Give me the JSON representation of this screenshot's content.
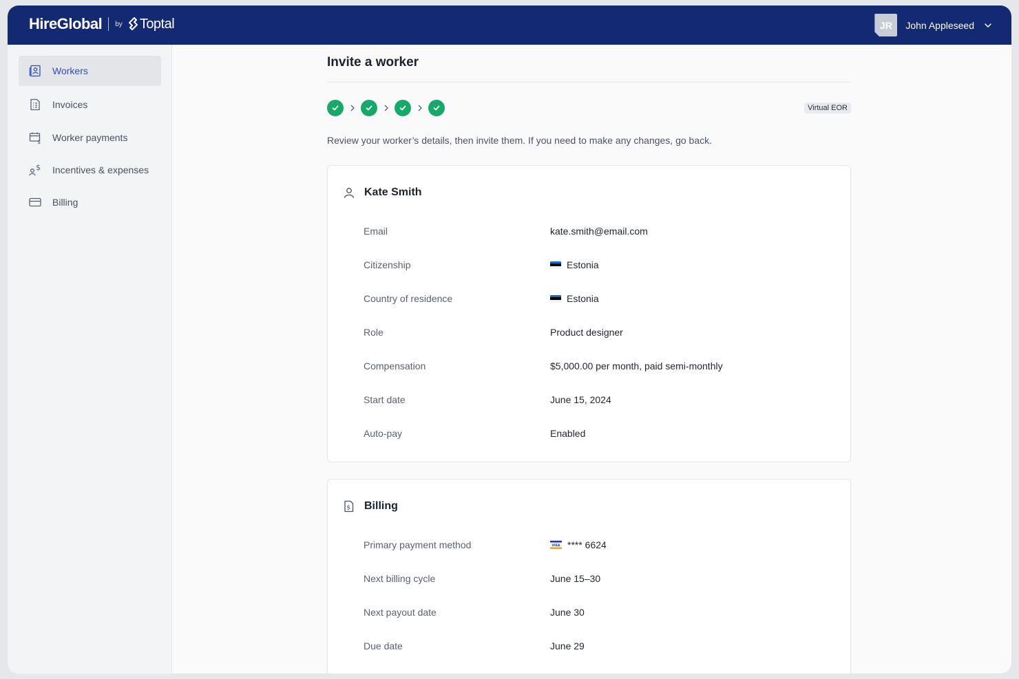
{
  "header": {
    "brand": "HireGlobal",
    "by": "by",
    "partner": "Toptal",
    "user": {
      "initials": "JR",
      "name": "John Appleseed"
    }
  },
  "sidebar": {
    "items": [
      {
        "label": "Workers",
        "icon": "workers-icon",
        "active": true
      },
      {
        "label": "Invoices",
        "icon": "invoices-icon",
        "active": false
      },
      {
        "label": "Worker payments",
        "icon": "worker-payments-icon",
        "active": false
      },
      {
        "label": "Incentives & expenses",
        "icon": "incentives-icon",
        "active": false
      },
      {
        "label": "Billing",
        "icon": "billing-card-icon",
        "active": false
      }
    ]
  },
  "page": {
    "title": "Invite a worker",
    "badge": "Virtual EOR",
    "steps_completed": 4,
    "intro": "Review your worker’s details, then invite them. If you need to make any changes, go back."
  },
  "worker_card": {
    "name": "Kate Smith",
    "rows": [
      {
        "label": "Email",
        "value": "kate.smith@email.com"
      },
      {
        "label": "Citizenship",
        "value": "Estonia",
        "flag": "estonia-flag"
      },
      {
        "label": "Country of residence",
        "value": "Estonia",
        "flag": "estonia-flag"
      },
      {
        "label": "Role",
        "value": "Product designer"
      },
      {
        "label": "Compensation",
        "value": "$5,000.00 per month, paid semi-monthly"
      },
      {
        "label": "Start date",
        "value": "June 15, 2024"
      },
      {
        "label": "Auto-pay",
        "value": "Enabled"
      }
    ]
  },
  "billing_card": {
    "title": "Billing",
    "rows": [
      {
        "label": "Primary payment method",
        "value": "**** 6624",
        "card_brand": "visa-icon"
      },
      {
        "label": "Next billing cycle",
        "value": "June 15–30"
      },
      {
        "label": "Next payout date",
        "value": "June 30"
      },
      {
        "label": "Due date",
        "value": "June 29"
      }
    ]
  },
  "colors": {
    "header_bg": "#132a73",
    "active_nav": "#2f4ec2",
    "step_complete": "#17a96b",
    "estonia_flag": [
      "#0072ce",
      "#000000",
      "#ffffff"
    ]
  }
}
